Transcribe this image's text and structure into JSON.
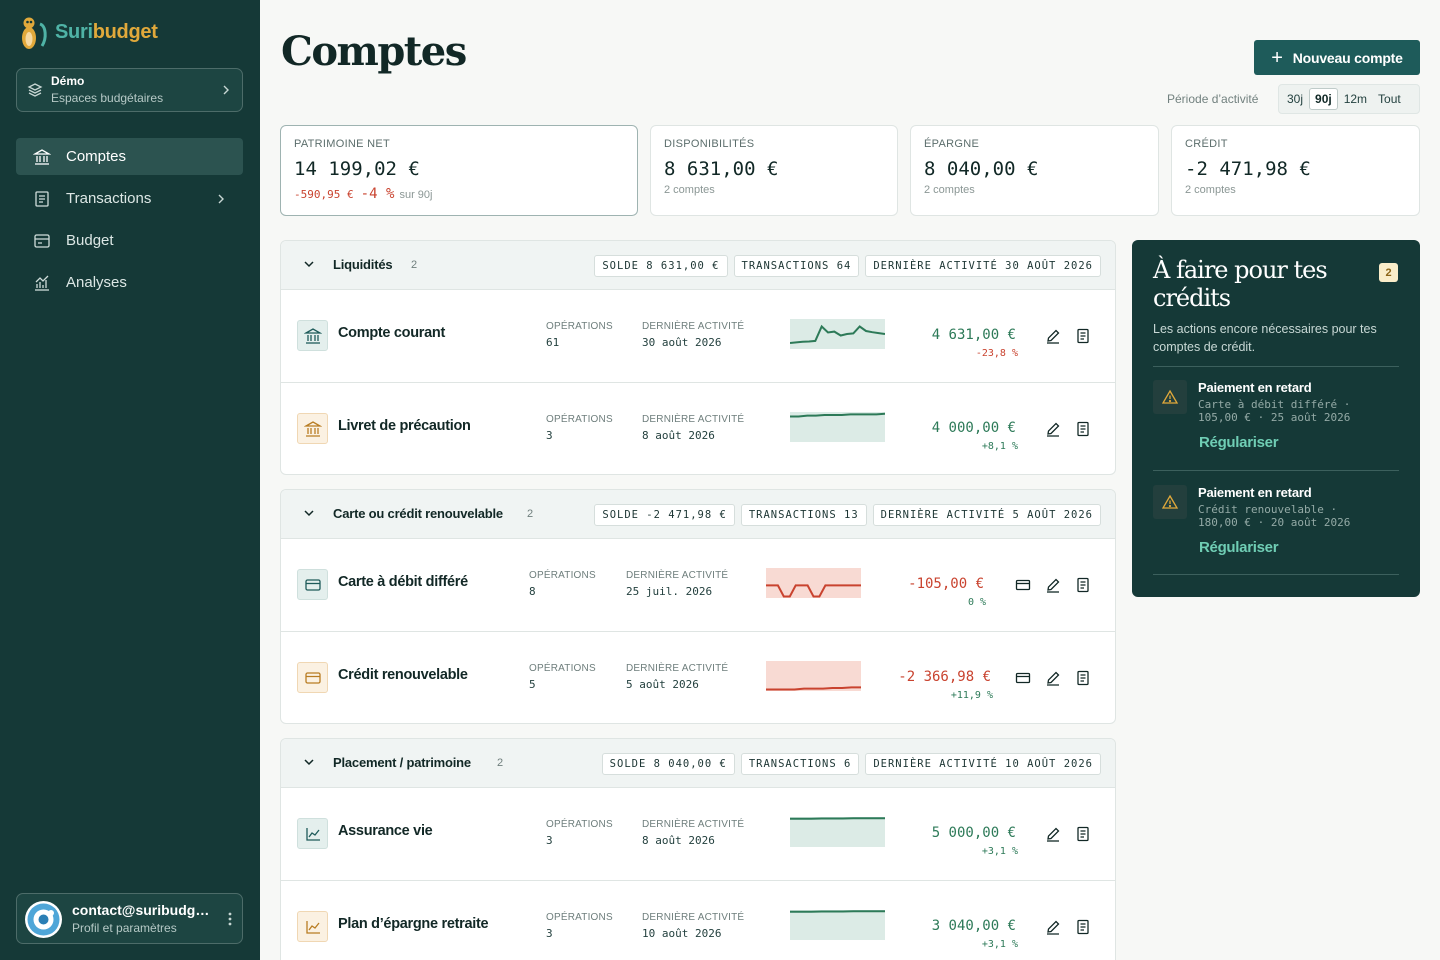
{
  "brand": {
    "name_a": "Suri",
    "name_b": "budget",
    "accent": "#1e5b5a"
  },
  "workspace": {
    "name": "Démo",
    "subtitle": "Espaces budgétaires"
  },
  "nav": [
    {
      "label": "Comptes",
      "icon": "bank-icon",
      "active": true
    },
    {
      "label": "Transactions",
      "icon": "receipt-icon",
      "has_chevron": true
    },
    {
      "label": "Budget",
      "icon": "wallet-icon"
    },
    {
      "label": "Analyses",
      "icon": "chart-icon"
    }
  ],
  "user": {
    "email": "contact@suribudget.fr",
    "subtitle": "Profil et paramètres"
  },
  "page": {
    "title": "Comptes",
    "new_account": "Nouveau compte",
    "period_label": "Période d’activité"
  },
  "period_options": [
    {
      "label": "30j"
    },
    {
      "label": "90j",
      "active": true
    },
    {
      "label": "12m"
    },
    {
      "label": "Tout"
    }
  ],
  "kpis": [
    {
      "label": "PATRIMOINE NET",
      "value": "14 199,02 €",
      "delta": "-590,95 €",
      "delta_pct": "-4 %",
      "delta_suffix": "sur 90j"
    },
    {
      "label": "DISPONIBILITÉS",
      "value": "8 631,00 €",
      "sub": "2 comptes"
    },
    {
      "label": "ÉPARGNE",
      "value": "8 040,00 €",
      "sub": "2 comptes"
    },
    {
      "label": "CRÉDIT",
      "value": "-2 471,98 €",
      "sub": "2 comptes"
    }
  ],
  "groups": [
    {
      "name": "Liquidités",
      "count": "2",
      "solde": "SOLDE 8 631,00 €",
      "transactions": "TRANSACTIONS 64",
      "last": "DERNIÈRE ACTIVITÉ 30 AOÛT 2026",
      "accounts": [
        {
          "name": "Compte courant",
          "ops_label": "OPÉRATIONS",
          "ops": "61",
          "last_label": "DERNIÈRE ACTIVITÉ",
          "last": "30 août 2026",
          "amount": "4 631,00 €",
          "pct": "-23,8 %",
          "amount_tone": "pos",
          "pct_tone": "neg",
          "trend": [
            0.8,
            0.78,
            0.76,
            0.75,
            0.73,
            0.25,
            0.45,
            0.42,
            0.55,
            0.5,
            0.48,
            0.25,
            0.4,
            0.44,
            0.47,
            0.5
          ],
          "icon": "bank-icon"
        },
        {
          "name": "Livret de précaution",
          "ops_label": "OPÉRATIONS",
          "ops": "3",
          "last_label": "DERNIÈRE ACTIVITÉ",
          "last": "8 août 2026",
          "amount": "4 000,00 €",
          "pct": "+8,1 %",
          "amount_tone": "pos",
          "pct_tone": "pos",
          "trend": [
            0.15,
            0.15,
            0.12,
            0.12,
            0.1,
            0.1,
            0.1,
            0.08,
            0.08,
            0.08,
            0.08,
            0.06
          ],
          "icon": "bank-icon"
        }
      ]
    },
    {
      "name": "Carte ou crédit renouvelable",
      "count": "2",
      "solde": "SOLDE -2 471,98 €",
      "transactions": "TRANSACTIONS 13",
      "last": "DERNIÈRE ACTIVITÉ 5 AOÛT 2026",
      "accounts": [
        {
          "name": "Carte à débit différé",
          "ops_label": "OPÉRATIONS",
          "ops": "8",
          "last_label": "DERNIÈRE ACTIVITÉ",
          "last": "25 juil. 2026",
          "amount": "-105,00 €",
          "pct": "0 %",
          "amount_tone": "neg",
          "pct_tone": "pos",
          "trend": [
            0.58,
            0.58,
            0.58,
            0.95,
            0.95,
            0.58,
            0.58,
            0.58,
            0.95,
            0.95,
            0.58,
            0.58,
            0.58,
            0.58,
            0.58,
            0.58,
            0.58
          ],
          "icon": "card-icon"
        },
        {
          "name": "Crédit renouvelable",
          "ops_label": "OPÉRATIONS",
          "ops": "5",
          "last_label": "DERNIÈRE ACTIVITÉ",
          "last": "5 août 2026",
          "amount": "-2 366,98 €",
          "pct": "+11,9 %",
          "amount_tone": "neg",
          "pct_tone": "pos",
          "trend": [
            0.95,
            0.95,
            0.95,
            0.95,
            0.92,
            0.92,
            0.92,
            0.9,
            0.9,
            0.88,
            0.88
          ],
          "icon": "card-icon"
        }
      ]
    },
    {
      "name": "Placement / patrimoine",
      "count": "2",
      "solde": "SOLDE 8 040,00 €",
      "transactions": "TRANSACTIONS 6",
      "last": "DERNIÈRE ACTIVITÉ 10 AOÛT 2026",
      "accounts": [
        {
          "name": "Assurance vie",
          "ops_label": "OPÉRATIONS",
          "ops": "3",
          "last_label": "DERNIÈRE ACTIVITÉ",
          "last": "8 août 2026",
          "amount": "5 000,00 €",
          "pct": "+3,1 %",
          "amount_tone": "pos",
          "pct_tone": "pos",
          "trend": [
            0.06,
            0.06,
            0.06,
            0.05,
            0.05,
            0.05,
            0.04,
            0.04,
            0.04,
            0.04
          ],
          "icon": "chart-icon"
        },
        {
          "name": "Plan d’épargne retraite",
          "ops_label": "OPÉRATIONS",
          "ops": "3",
          "last_label": "DERNIÈRE ACTIVITÉ",
          "last": "10 août 2026",
          "amount": "3 040,00 €",
          "pct": "+3,1 %",
          "amount_tone": "pos",
          "pct_tone": "pos",
          "trend": [
            0.06,
            0.06,
            0.06,
            0.05,
            0.05,
            0.05,
            0.04,
            0.04,
            0.04,
            0.04
          ],
          "icon": "chart-icon"
        }
      ]
    }
  ],
  "todo": {
    "title": "À faire pour tes crédits",
    "badge": "2",
    "desc": "Les actions encore nécessaires pour tes comptes de crédit.",
    "items": [
      {
        "title": "Paiement en retard",
        "line1": "Carte à débit différé ·",
        "line2": "105,00 € · 25 août 2026",
        "action": "Régulariser"
      },
      {
        "title": "Paiement en retard",
        "line1": "Crédit renouvelable ·",
        "line2": "180,00 € · 20 août 2026",
        "action": "Régulariser"
      }
    ]
  },
  "colors": {
    "positive": "#2d7a58",
    "negative": "#c9432f",
    "sidebar": "#153937"
  }
}
